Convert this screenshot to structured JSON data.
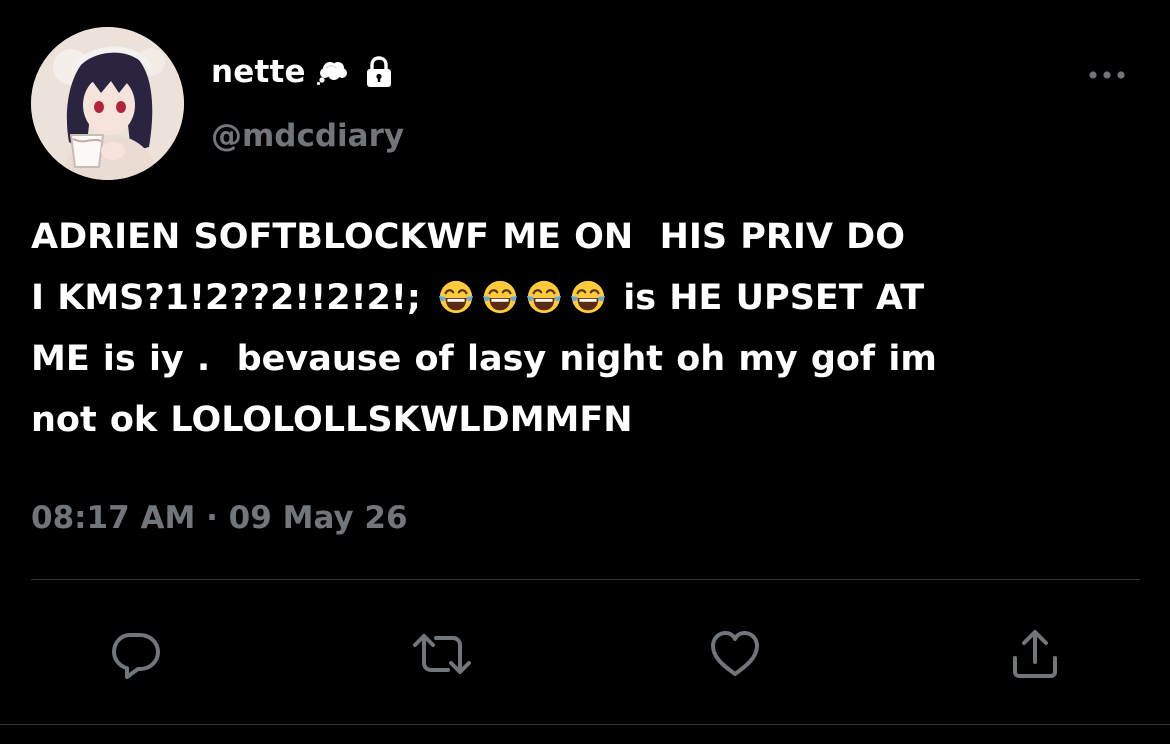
{
  "tweet": {
    "display_name": "nette",
    "handle": "@mdcdiary",
    "text_line1": "ADRIEN SOFTBLOCKWF ME ON  HIS PRIV DO",
    "text_line2_a": "I KMS?1!2??2!!2!2!; ",
    "text_line2_b": " is HE UPSET AT",
    "text_line3": "ME is iy .  bevause of lasy night oh my gof im",
    "text_line4": "not ok LOLOLOLLSKWLDMMFN",
    "emoji_count": 4,
    "timestamp": "08:17 AM · 09 May 26"
  },
  "icons": {
    "name_badge": "thought-bubble-icon",
    "protected": "lock-icon",
    "more": "more-options-icon",
    "emoji": "tears-of-joy-emoji",
    "reply": "reply-icon",
    "retweet": "retweet-icon",
    "like": "like-icon",
    "share": "share-icon"
  },
  "colors": {
    "background": "#000000",
    "text": "#ffffff",
    "secondary": "#71767b",
    "divider": "#2f3336"
  }
}
